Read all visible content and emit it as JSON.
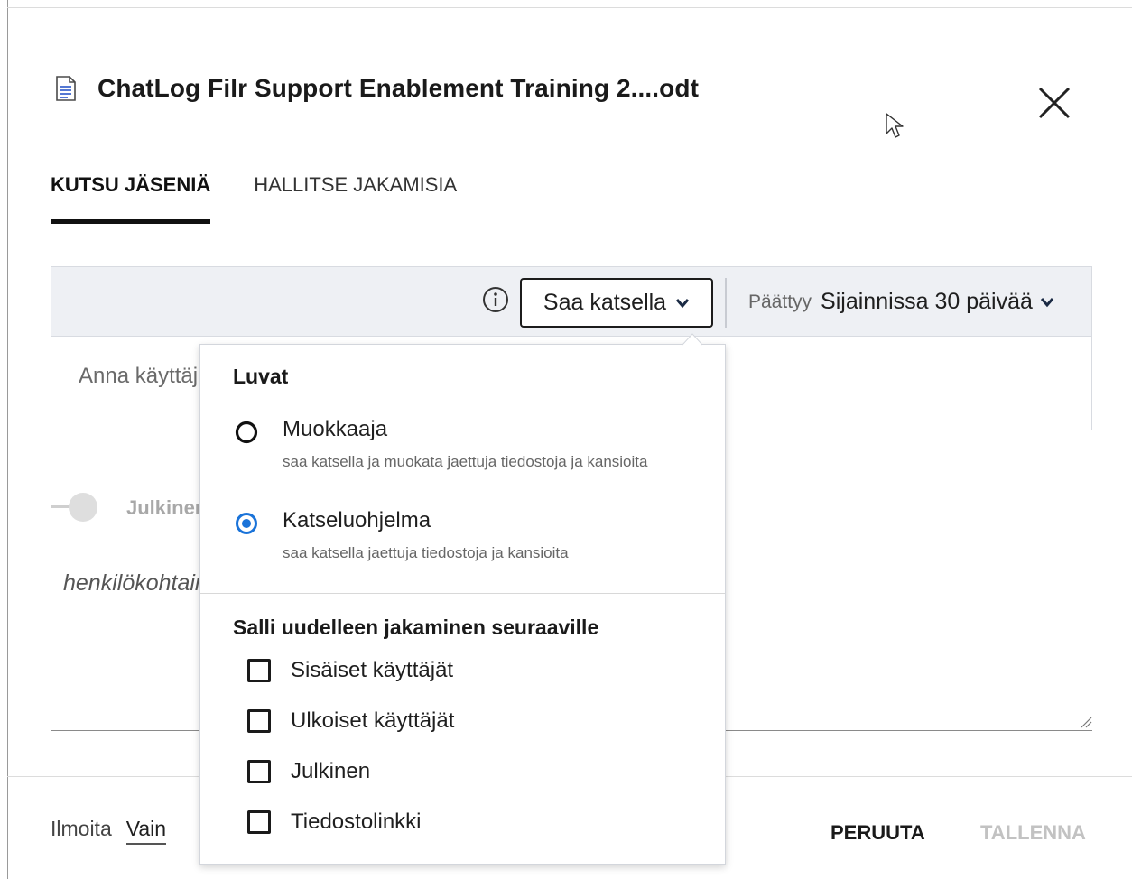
{
  "dialog": {
    "file_icon": "document-icon",
    "title": "ChatLog Filr Support Enablement Training 2....odt",
    "close_icon": "close-icon"
  },
  "tabs": [
    {
      "label": "KUTSU JÄSENIÄ",
      "active": true
    },
    {
      "label": "HALLITSE JAKAMISIA",
      "active": false
    }
  ],
  "share_bar": {
    "info_icon": "info-icon",
    "permission_label": "Saa katsella",
    "expires_label": "Päättyy",
    "expires_value": "Sijainnissa 30 päivää"
  },
  "user_input": {
    "placeholder": "Anna käyttäjä"
  },
  "public_toggle": {
    "label": "Julkinen",
    "on": false
  },
  "note": {
    "placeholder": "henkilökohtainen"
  },
  "footer": {
    "notify_label": "Ilmoita",
    "notify_value": "Vain",
    "cancel_label": "PERUUTA",
    "save_label": "TALLENNA"
  },
  "permissions_dropdown": {
    "heading": "Luvat",
    "options": [
      {
        "title": "Muokkaaja",
        "description": "saa katsella ja muokata jaettuja tiedostoja ja kansioita",
        "selected": false
      },
      {
        "title": "Katseluohjelma",
        "description": "saa katsella jaettuja tiedostoja ja kansioita",
        "selected": true
      }
    ],
    "reshare_heading": "Salli uudelleen jakaminen seuraaville",
    "reshare_options": [
      {
        "label": "Sisäiset käyttäjät",
        "checked": false
      },
      {
        "label": "Ulkoiset käyttäjät",
        "checked": false
      },
      {
        "label": "Julkinen",
        "checked": false
      },
      {
        "label": "Tiedostolinkki",
        "checked": false
      }
    ]
  },
  "colors": {
    "accent_blue": "#1a73d9",
    "bar_bg": "#eef0f4",
    "disabled_text": "#c2c2c2"
  }
}
